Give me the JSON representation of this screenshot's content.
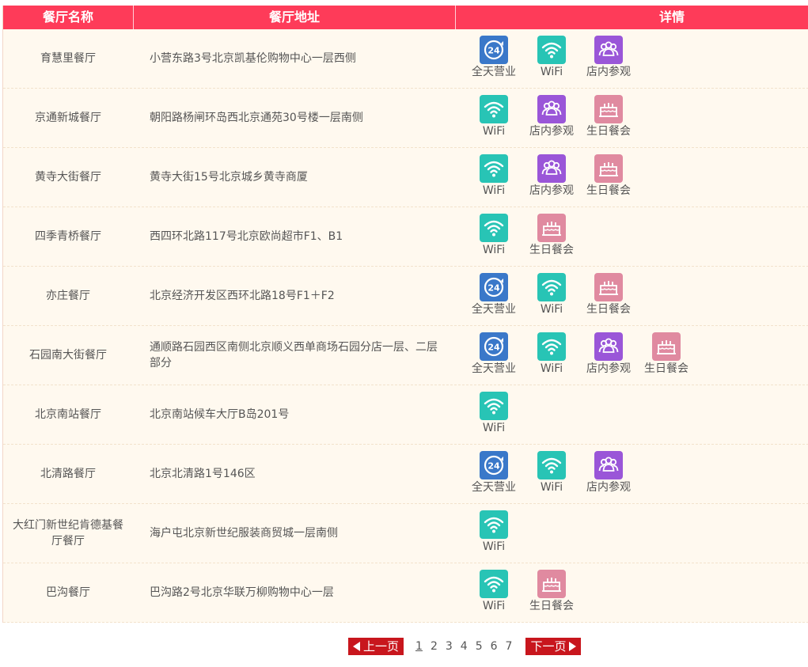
{
  "header": {
    "name": "餐厅名称",
    "address": "餐厅地址",
    "details": "详情"
  },
  "feature_labels": {
    "24h": "全天营业",
    "wifi": "WiFi",
    "visit": "店内参观",
    "birthday": "生日餐会"
  },
  "icons": {
    "24h": "clock-24-icon",
    "wifi": "wifi-icon",
    "visit": "people-icon",
    "birthday": "cake-icon"
  },
  "colors": {
    "header_bg": "#fe3b59",
    "table_bg": "#fff9ef",
    "icon_24h": "#3a78c9",
    "icon_wifi": "#28c4b5",
    "icon_visit": "#9a56d8",
    "icon_birthday": "#e08aa0",
    "pager_btn": "#c8161d"
  },
  "rows": [
    {
      "name": "育慧里餐厅",
      "address": "小营东路3号北京凯基伦购物中心一层西侧",
      "features": [
        "24h",
        "wifi",
        "visit"
      ]
    },
    {
      "name": "京通新城餐厅",
      "address": "朝阳路杨闸环岛西北京通苑30号楼一层南侧",
      "features": [
        "wifi",
        "visit",
        "birthday"
      ]
    },
    {
      "name": "黄寺大街餐厅",
      "address": "黄寺大街15号北京城乡黄寺商厦",
      "features": [
        "wifi",
        "visit",
        "birthday"
      ]
    },
    {
      "name": "四季青桥餐厅",
      "address": "西四环北路117号北京欧尚超市F1、B1",
      "features": [
        "wifi",
        "birthday"
      ]
    },
    {
      "name": "亦庄餐厅",
      "address": "北京经济开发区西环北路18号F1＋F2",
      "features": [
        "24h",
        "wifi",
        "birthday"
      ]
    },
    {
      "name": "石园南大街餐厅",
      "address": "通顺路石园西区南侧北京顺义西单商场石园分店一层、二层部分",
      "features": [
        "24h",
        "wifi",
        "visit",
        "birthday"
      ]
    },
    {
      "name": "北京南站餐厅",
      "address": "北京南站候车大厅B岛201号",
      "features": [
        "wifi"
      ]
    },
    {
      "name": "北清路餐厅",
      "address": "北京北清路1号146区",
      "features": [
        "24h",
        "wifi",
        "visit"
      ]
    },
    {
      "name": "大红门新世纪肯德基餐厅餐厅",
      "address": "海户屯北京新世纪服装商贸城一层南侧",
      "features": [
        "wifi"
      ]
    },
    {
      "name": "巴沟餐厅",
      "address": "巴沟路2号北京华联万柳购物中心一层",
      "features": [
        "wifi",
        "birthday"
      ]
    }
  ],
  "pager": {
    "prev": "上一页",
    "next": "下一页",
    "pages": [
      "1",
      "2",
      "3",
      "4",
      "5",
      "6",
      "7"
    ],
    "current": "1"
  }
}
